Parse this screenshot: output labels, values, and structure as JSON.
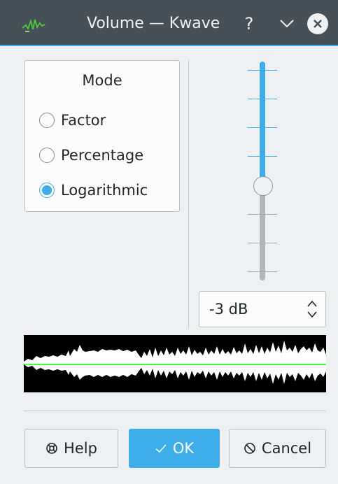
{
  "window": {
    "title": "Volume — Kwave",
    "help_glyph": "?",
    "app_icon": "kwave-waveform-icon"
  },
  "mode": {
    "title": "Mode",
    "options": [
      {
        "label": "Factor",
        "checked": false
      },
      {
        "label": "Percentage",
        "checked": false
      },
      {
        "label": "Logarithmic",
        "checked": true
      }
    ]
  },
  "slider": {
    "level_fraction": 0.55
  },
  "spinbox": {
    "value": "-3 dB"
  },
  "buttons": {
    "help": "Help",
    "ok": "OK",
    "cancel": "Cancel"
  },
  "colors": {
    "accent": "#3daee9",
    "titlebar": "#475057",
    "waveform_bg": "#000000",
    "waveform_fg": "#ffffff",
    "waveform_line": "#00ff00"
  }
}
